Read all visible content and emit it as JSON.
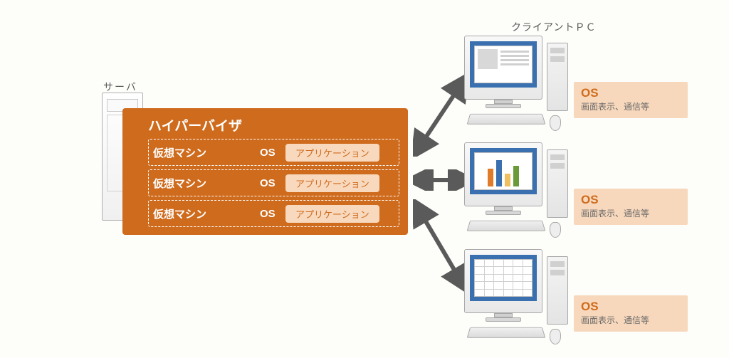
{
  "labels": {
    "server": "サーバ",
    "client_pc": "クライアントＰＣ"
  },
  "hypervisor": {
    "title": "ハイパーバイザ",
    "vms": [
      {
        "name": "仮想マシン",
        "os": "OS",
        "app": "アプリケーション"
      },
      {
        "name": "仮想マシン",
        "os": "OS",
        "app": "アプリケーション"
      },
      {
        "name": "仮想マシン",
        "os": "OS",
        "app": "アプリケーション"
      }
    ]
  },
  "clients": [
    {
      "os_label": "OS",
      "os_sub": "画面表示、通信等",
      "screen": "doc"
    },
    {
      "os_label": "OS",
      "os_sub": "画面表示、通信等",
      "screen": "chart"
    },
    {
      "os_label": "OS",
      "os_sub": "画面表示、通信等",
      "screen": "grid"
    }
  ],
  "colors": {
    "hypervisor_bg": "#cf6b1d",
    "app_bg": "#f8d9be",
    "os_card_bg": "#f8d8bc",
    "arrow": "#5a5a5a",
    "screen_bg": "#3a6fb0"
  }
}
